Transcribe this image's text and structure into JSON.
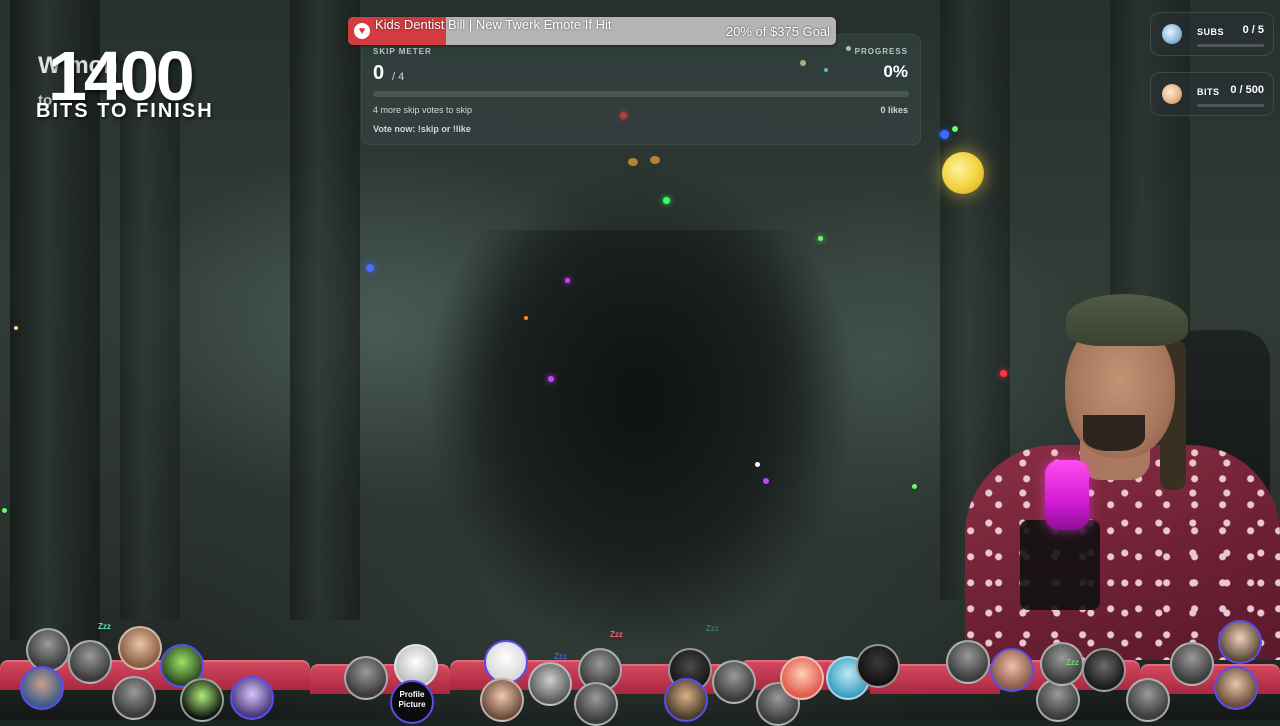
{
  "counter": {
    "number": "1400",
    "caption": "BITS TO FINISH",
    "ghost_text": "W                          mon",
    "ghost_text2": "to"
  },
  "goal": {
    "title": "Kids Dentist Bill | New Twerk Emote If Hit",
    "progress_text": "20% of $375 Goal",
    "progress_fraction": 0.2,
    "icon": "heart-icon",
    "color": "#d23b3f"
  },
  "skip_meter": {
    "label": "SKIP METER",
    "count": "0",
    "total": "/ 4",
    "progress_label": "PROGRESS",
    "progress_value": "0%",
    "votes_text": "4 more skip votes to skip",
    "likes_text": "0 likes",
    "vote_text": "Vote now: !skip or !like"
  },
  "stats": {
    "subs": {
      "label": "SUBS",
      "value": "0 / 5",
      "icon": "subs-icon"
    },
    "bits": {
      "label": "BITS",
      "value": "0 / 500",
      "icon": "bits-icon"
    }
  },
  "audience": {
    "profile_placeholder": "Profile Picture",
    "zzz": "Zzz",
    "seat_color": "#c93a52"
  }
}
